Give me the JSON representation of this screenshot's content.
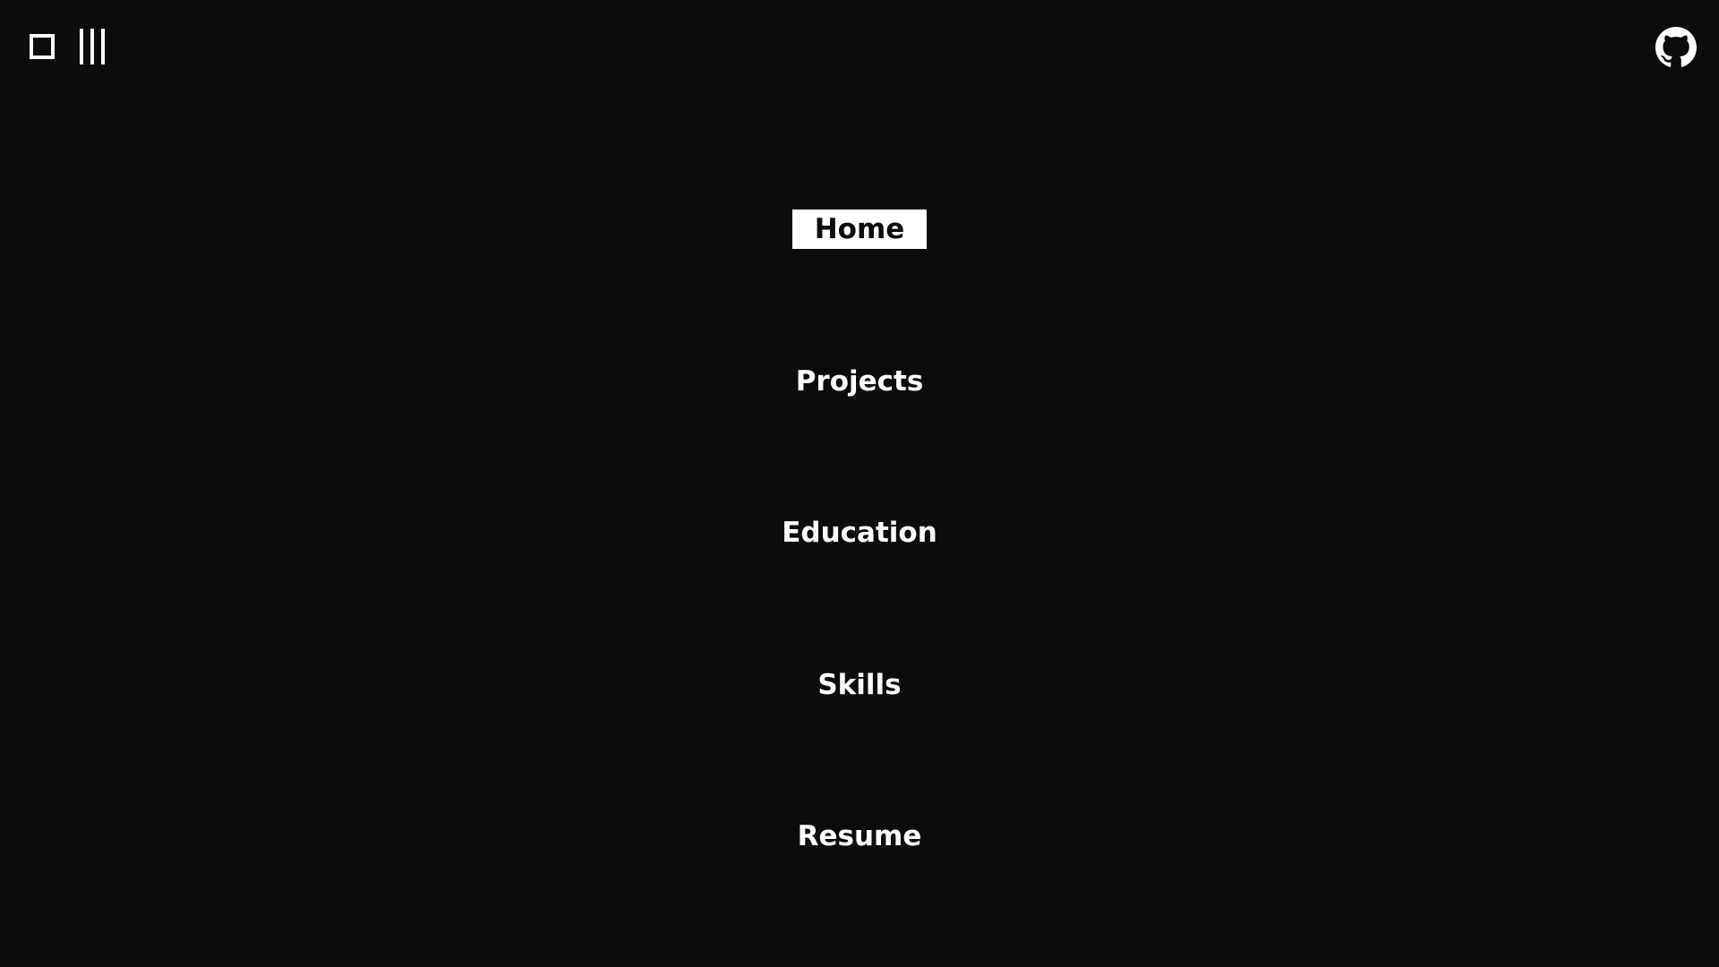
{
  "colors": {
    "background": "#0c0c0c",
    "foreground": "#ffffff",
    "active_text": "#0c0c0c"
  },
  "toolbar": {
    "square_icon": "square-outline-icon",
    "columns_icon": "three-bars-icon"
  },
  "header": {
    "github_icon": "github-icon"
  },
  "nav": {
    "active": "Home",
    "items": [
      {
        "label": "Home"
      },
      {
        "label": "Projects"
      },
      {
        "label": "Education"
      },
      {
        "label": "Skills"
      },
      {
        "label": "Resume"
      }
    ]
  }
}
